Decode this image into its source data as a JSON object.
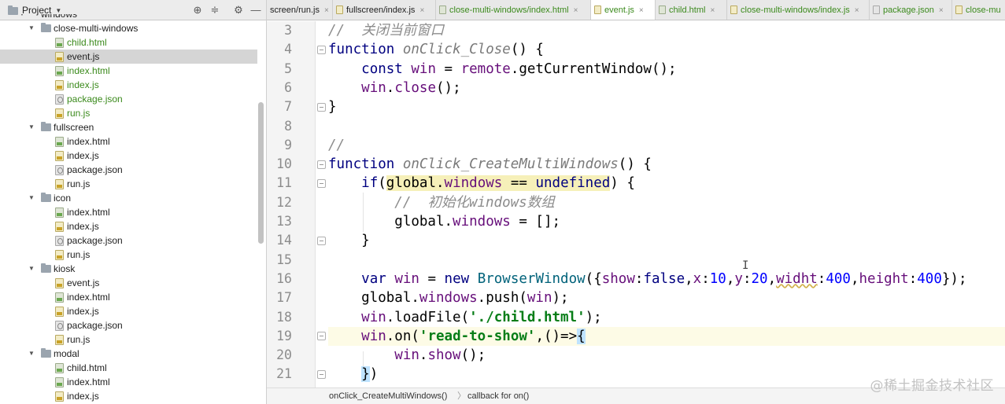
{
  "project_panel": {
    "title": "Project",
    "root_folder": "windows",
    "tree": [
      {
        "label": "close-multi-windows",
        "type": "folder"
      },
      {
        "label": "child.html",
        "type": "html",
        "vcs": "added"
      },
      {
        "label": "event.js",
        "type": "js",
        "vcs": "none",
        "selected": true
      },
      {
        "label": "index.html",
        "type": "html",
        "vcs": "added"
      },
      {
        "label": "index.js",
        "type": "js",
        "vcs": "added"
      },
      {
        "label": "package.json",
        "type": "json",
        "vcs": "added"
      },
      {
        "label": "run.js",
        "type": "js",
        "vcs": "added"
      },
      {
        "label": "fullscreen",
        "type": "folder"
      },
      {
        "label": "index.html",
        "type": "html",
        "vcs": "none"
      },
      {
        "label": "index.js",
        "type": "js",
        "vcs": "none"
      },
      {
        "label": "package.json",
        "type": "json",
        "vcs": "none"
      },
      {
        "label": "run.js",
        "type": "js",
        "vcs": "none"
      },
      {
        "label": "icon",
        "type": "folder"
      },
      {
        "label": "index.html",
        "type": "html",
        "vcs": "none"
      },
      {
        "label": "index.js",
        "type": "js",
        "vcs": "none"
      },
      {
        "label": "package.json",
        "type": "json",
        "vcs": "none"
      },
      {
        "label": "run.js",
        "type": "js",
        "vcs": "none"
      },
      {
        "label": "kiosk",
        "type": "folder"
      },
      {
        "label": "event.js",
        "type": "js",
        "vcs": "none"
      },
      {
        "label": "index.html",
        "type": "html",
        "vcs": "none"
      },
      {
        "label": "index.js",
        "type": "js",
        "vcs": "none"
      },
      {
        "label": "package.json",
        "type": "json",
        "vcs": "none"
      },
      {
        "label": "run.js",
        "type": "js",
        "vcs": "none"
      },
      {
        "label": "modal",
        "type": "folder"
      },
      {
        "label": "child.html",
        "type": "html",
        "vcs": "none"
      },
      {
        "label": "index.html",
        "type": "html",
        "vcs": "none"
      },
      {
        "label": "index.js",
        "type": "js",
        "vcs": "none"
      }
    ]
  },
  "tabs": [
    {
      "label": "screen/run.js",
      "icon": "js",
      "vcs": "none"
    },
    {
      "label": "fullscreen/index.js",
      "icon": "js",
      "vcs": "none"
    },
    {
      "label": "close-multi-windows/index.html",
      "icon": "html",
      "vcs": "added"
    },
    {
      "label": "event.js",
      "icon": "js",
      "vcs": "added",
      "active": true
    },
    {
      "label": "child.html",
      "icon": "html",
      "vcs": "added"
    },
    {
      "label": "close-multi-windows/index.js",
      "icon": "js",
      "vcs": "added"
    },
    {
      "label": "package.json",
      "icon": "json",
      "vcs": "added"
    },
    {
      "label": "close-mu",
      "icon": "js",
      "vcs": "added"
    }
  ],
  "editor": {
    "line_numbers": [
      "3",
      "4",
      "5",
      "6",
      "7",
      "8",
      "9",
      "10",
      "11",
      "12",
      "13",
      "14",
      "15",
      "16",
      "17",
      "18",
      "19",
      "20",
      "21"
    ],
    "current_line": "19"
  },
  "breadcrumb": [
    "onClick_CreateMultiWindows()",
    "callback for on()"
  ],
  "watermark": "@稀土掘金技术社区",
  "colors": {
    "keyword": "#000080",
    "string": "#067d17",
    "number": "#0000ff",
    "property": "#660e7a",
    "comment": "#8c8c8c",
    "vcs_added": "#3b8a1c",
    "selection": "#d5d5d5",
    "current_line": "#fdfbe6"
  }
}
